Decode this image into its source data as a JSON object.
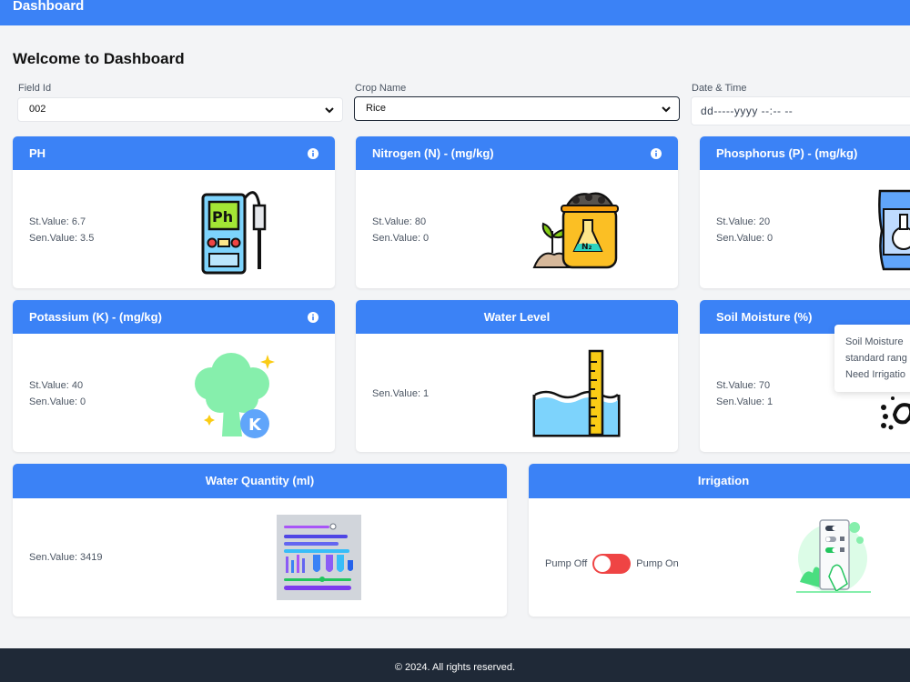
{
  "header": {
    "brand": "Dashboard"
  },
  "page": {
    "welcome": "Welcome to Dashboard"
  },
  "filters": {
    "field_id": {
      "label": "Field Id",
      "value": "002"
    },
    "crop_name": {
      "label": "Crop Name",
      "value": "Rice"
    },
    "date_time": {
      "label": "Date & Time",
      "value": "dd-----yyyy --:-- --"
    }
  },
  "cards": {
    "ph": {
      "title": "PH",
      "st_value": "St.Value: 6.7",
      "sen_value": "Sen.Value: 3.5"
    },
    "nitrogen": {
      "title": "Nitrogen (N) - (mg/kg)",
      "st_value": "St.Value: 80",
      "sen_value": "Sen.Value: 0"
    },
    "phosphorus": {
      "title": "Phosphorus (P) - (mg/kg)",
      "st_value": "St.Value: 20",
      "sen_value": "Sen.Value: 0"
    },
    "potassium": {
      "title": "Potassium (K) - (mg/kg)",
      "st_value": "St.Value: 40",
      "sen_value": "Sen.Value: 0"
    },
    "water_level": {
      "title": "Water Level",
      "sen_value": "Sen.Value: 1"
    },
    "soil_moisture": {
      "title": "Soil Moisture (%)",
      "st_value": "St.Value: 70",
      "sen_value": "Sen.Value: 1"
    },
    "water_quantity": {
      "title": "Water Quantity (ml)",
      "sen_value": "Sen.Value: 3419"
    },
    "irrigation": {
      "title": "Irrigation",
      "pump_off": "Pump Off",
      "pump_on": "Pump On"
    }
  },
  "tooltip": {
    "line1": "Soil Moisture",
    "line2": "standard rang",
    "line3": "Need Irrigatio"
  },
  "footer": {
    "text": "© 2024. All rights reserved."
  },
  "colors": {
    "primary": "#3b82f6",
    "footer": "#1f2937",
    "toggle_off": "#ef4444"
  }
}
